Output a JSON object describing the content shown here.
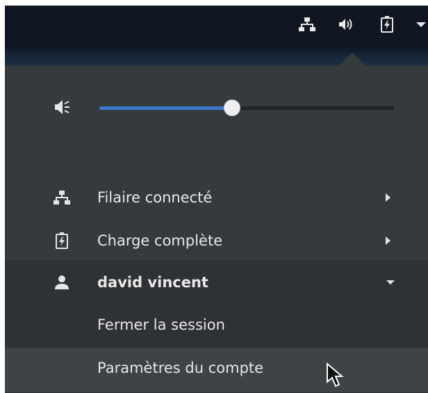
{
  "top_bar": {
    "tray_icons": [
      "network-wired-icon",
      "speaker-icon",
      "battery-charging-icon",
      "dropdown-arrow-icon"
    ]
  },
  "volume": {
    "icon": "speaker-muted-icon",
    "level_fraction": 0.45
  },
  "menu_items": [
    {
      "icon": "network-wired-icon",
      "label": "Filaire connecté",
      "submenu": true
    },
    {
      "icon": "battery-charging-icon",
      "label": "Charge complète",
      "submenu": true
    }
  ],
  "user": {
    "icon": "user-icon",
    "name": "david vincent",
    "expanded": true,
    "actions": [
      {
        "label": "Fermer la session"
      },
      {
        "label": "Paramètres du compte",
        "hovered": true
      }
    ]
  },
  "colors": {
    "panel_bg": "#353a3c",
    "accent": "#3a78c9",
    "top_bar": "#101722",
    "hover": "#3e4346"
  }
}
